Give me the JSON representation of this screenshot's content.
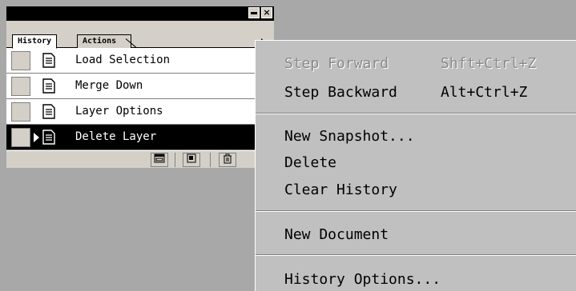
{
  "palette": {
    "tabs": [
      {
        "label": "History"
      },
      {
        "label": "Actions"
      }
    ],
    "titlebar": {
      "minimize": "",
      "close": "×"
    },
    "items": [
      {
        "label": "Load Selection",
        "selected": false
      },
      {
        "label": "Merge Down",
        "selected": false
      },
      {
        "label": "Layer Options",
        "selected": false
      },
      {
        "label": "Delete Layer",
        "selected": true
      }
    ],
    "footer_icons": [
      "new-snapshot-icon",
      "new-document-icon",
      "trash-icon"
    ]
  },
  "menu": {
    "items": [
      {
        "label": "Step Forward",
        "shortcut": "Shft+Ctrl+Z",
        "disabled": true
      },
      {
        "label": "Step Backward",
        "shortcut": "Alt+Ctrl+Z",
        "disabled": false
      },
      {
        "label": "New Snapshot...",
        "shortcut": "",
        "disabled": false
      },
      {
        "label": "Delete",
        "shortcut": "",
        "disabled": false
      },
      {
        "label": "Clear History",
        "shortcut": "",
        "disabled": false
      },
      {
        "label": "New Document",
        "shortcut": "",
        "disabled": false
      },
      {
        "label": "History Options...",
        "shortcut": "",
        "disabled": false
      }
    ]
  }
}
